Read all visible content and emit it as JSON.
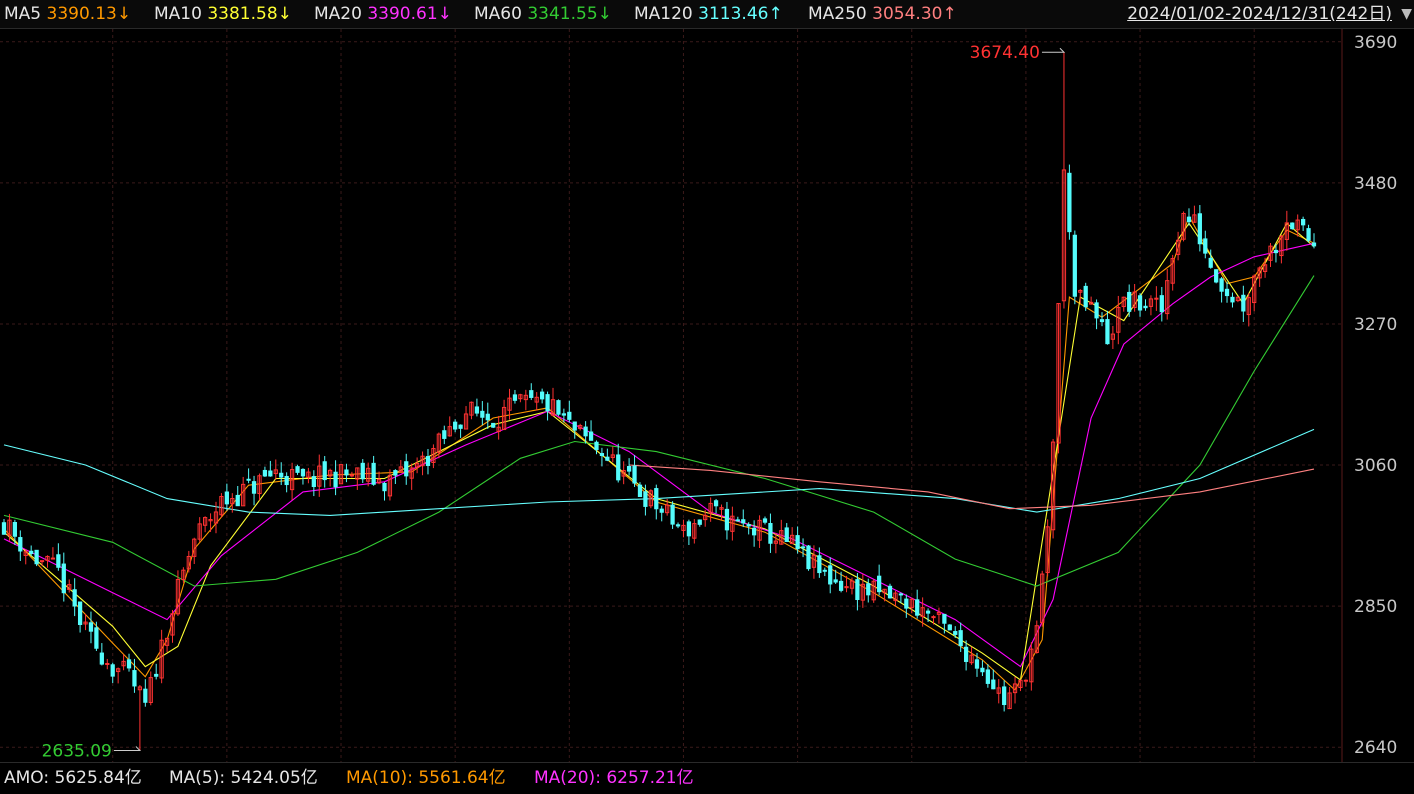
{
  "header": {
    "ma": [
      {
        "name": "MA5",
        "value": "3390.13↓",
        "color": "#ff9900"
      },
      {
        "name": "MA10",
        "value": "3381.58↓",
        "color": "#ffff33"
      },
      {
        "name": "MA20",
        "value": "3390.61↓",
        "color": "#ff00ff"
      },
      {
        "name": "MA60",
        "value": "3341.55↓",
        "color": "#33cc33"
      },
      {
        "name": "MA120",
        "value": "3113.46↑",
        "color": "#66ffff"
      },
      {
        "name": "MA250",
        "value": "3054.30↑",
        "color": "#ff8080"
      }
    ],
    "range": "2024/01/02-2024/12/31(242日)"
  },
  "footer": {
    "amo": "AMO: 5625.84亿",
    "ma5": "MA(5): 5424.05亿",
    "ma10": "MA(10): 5561.64亿",
    "ma20": "MA(20): 6257.21亿"
  },
  "chart_data": {
    "type": "candlestick",
    "y_ticks": [
      2640,
      2850,
      3060,
      3270,
      3480,
      3690
    ],
    "ylim": [
      2618,
      3709
    ],
    "n_bars": 242,
    "high_label": "3674.40",
    "low_label": "2635.09",
    "colors": {
      "up": "#ff3232",
      "down": "#54fcfc",
      "grid": "#3a1a1a",
      "axis_text": "#c8c8c8",
      "high_label": "#ff3232",
      "low_label": "#33cc33"
    },
    "anchors": [
      [
        0,
        2975
      ],
      [
        5,
        2925
      ],
      [
        10,
        2900
      ],
      [
        15,
        2810
      ],
      [
        20,
        2760
      ],
      [
        23,
        2745
      ],
      [
        26,
        2700
      ],
      [
        30,
        2820
      ],
      [
        35,
        2950
      ],
      [
        40,
        3005
      ],
      [
        45,
        3025
      ],
      [
        50,
        3050
      ],
      [
        55,
        3035
      ],
      [
        60,
        3045
      ],
      [
        65,
        3045
      ],
      [
        70,
        3035
      ],
      [
        75,
        3050
      ],
      [
        80,
        3090
      ],
      [
        85,
        3140
      ],
      [
        90,
        3130
      ],
      [
        95,
        3150
      ],
      [
        100,
        3150
      ],
      [
        105,
        3110
      ],
      [
        110,
        3080
      ],
      [
        115,
        3035
      ],
      [
        120,
        3000
      ],
      [
        125,
        2960
      ],
      [
        130,
        2990
      ],
      [
        135,
        2970
      ],
      [
        140,
        2960
      ],
      [
        145,
        2940
      ],
      [
        150,
        2900
      ],
      [
        155,
        2880
      ],
      [
        160,
        2870
      ],
      [
        165,
        2860
      ],
      [
        170,
        2840
      ],
      [
        175,
        2800
      ],
      [
        180,
        2760
      ],
      [
        184,
        2710
      ],
      [
        187,
        2730
      ],
      [
        190,
        2810
      ],
      [
        192,
        2960
      ],
      [
        193,
        3100
      ],
      [
        194,
        3300
      ],
      [
        195,
        3489
      ],
      [
        196,
        3420
      ],
      [
        197,
        3310
      ],
      [
        200,
        3290
      ],
      [
        203,
        3250
      ],
      [
        206,
        3300
      ],
      [
        210,
        3300
      ],
      [
        213,
        3290
      ],
      [
        215,
        3380
      ],
      [
        217,
        3430
      ],
      [
        219,
        3420
      ],
      [
        222,
        3360
      ],
      [
        225,
        3320
      ],
      [
        228,
        3300
      ],
      [
        231,
        3360
      ],
      [
        234,
        3390
      ],
      [
        236,
        3430
      ],
      [
        238,
        3410
      ],
      [
        241,
        3390
      ]
    ],
    "ma_lines": [
      {
        "name": "MA5",
        "color": "#ff9900",
        "points": [
          [
            0,
            2965
          ],
          [
            20,
            2795
          ],
          [
            26,
            2745
          ],
          [
            30,
            2800
          ],
          [
            35,
            2935
          ],
          [
            45,
            3030
          ],
          [
            60,
            3045
          ],
          [
            75,
            3050
          ],
          [
            90,
            3130
          ],
          [
            100,
            3145
          ],
          [
            120,
            3005
          ],
          [
            140,
            2960
          ],
          [
            160,
            2870
          ],
          [
            180,
            2770
          ],
          [
            186,
            2725
          ],
          [
            191,
            2800
          ],
          [
            196,
            3310
          ],
          [
            202,
            3280
          ],
          [
            215,
            3360
          ],
          [
            218,
            3430
          ],
          [
            225,
            3330
          ],
          [
            230,
            3340
          ],
          [
            236,
            3410
          ],
          [
            241,
            3390
          ]
        ]
      },
      {
        "name": "MA10",
        "color": "#ffff33",
        "points": [
          [
            0,
            2960
          ],
          [
            20,
            2820
          ],
          [
            26,
            2760
          ],
          [
            32,
            2790
          ],
          [
            38,
            2910
          ],
          [
            50,
            3040
          ],
          [
            70,
            3040
          ],
          [
            90,
            3120
          ],
          [
            100,
            3140
          ],
          [
            120,
            3010
          ],
          [
            140,
            2965
          ],
          [
            160,
            2880
          ],
          [
            180,
            2780
          ],
          [
            187,
            2740
          ],
          [
            193,
            3050
          ],
          [
            198,
            3310
          ],
          [
            206,
            3275
          ],
          [
            218,
            3420
          ],
          [
            228,
            3300
          ],
          [
            236,
            3420
          ],
          [
            241,
            3385
          ]
        ]
      },
      {
        "name": "MA20",
        "color": "#ff00ff",
        "points": [
          [
            0,
            2950
          ],
          [
            20,
            2870
          ],
          [
            30,
            2830
          ],
          [
            40,
            2925
          ],
          [
            55,
            3020
          ],
          [
            70,
            3035
          ],
          [
            85,
            3090
          ],
          [
            100,
            3140
          ],
          [
            115,
            3080
          ],
          [
            130,
            2990
          ],
          [
            145,
            2950
          ],
          [
            160,
            2890
          ],
          [
            175,
            2830
          ],
          [
            187,
            2760
          ],
          [
            193,
            2860
          ],
          [
            200,
            3130
          ],
          [
            206,
            3240
          ],
          [
            215,
            3300
          ],
          [
            222,
            3340
          ],
          [
            230,
            3370
          ],
          [
            241,
            3390
          ]
        ]
      },
      {
        "name": "MA60",
        "color": "#33cc33",
        "points": [
          [
            0,
            2985
          ],
          [
            20,
            2945
          ],
          [
            35,
            2880
          ],
          [
            50,
            2890
          ],
          [
            65,
            2930
          ],
          [
            80,
            2990
          ],
          [
            95,
            3070
          ],
          [
            105,
            3095
          ],
          [
            120,
            3080
          ],
          [
            140,
            3040
          ],
          [
            160,
            2990
          ],
          [
            175,
            2920
          ],
          [
            190,
            2880
          ],
          [
            205,
            2930
          ],
          [
            220,
            3060
          ],
          [
            230,
            3200
          ],
          [
            241,
            3342
          ]
        ]
      },
      {
        "name": "MA120",
        "color": "#66ffff",
        "points": [
          [
            0,
            3090
          ],
          [
            15,
            3060
          ],
          [
            30,
            3010
          ],
          [
            45,
            2990
          ],
          [
            60,
            2985
          ],
          [
            80,
            2995
          ],
          [
            100,
            3005
          ],
          [
            120,
            3010
          ],
          [
            150,
            3025
          ],
          [
            175,
            3010
          ],
          [
            190,
            2990
          ],
          [
            205,
            3010
          ],
          [
            220,
            3040
          ],
          [
            241,
            3113
          ]
        ]
      },
      {
        "name": "MA250",
        "color": "#ff8080",
        "points": [
          [
            115,
            3060
          ],
          [
            130,
            3052
          ],
          [
            150,
            3035
          ],
          [
            170,
            3020
          ],
          [
            185,
            2995
          ],
          [
            200,
            3000
          ],
          [
            220,
            3020
          ],
          [
            241,
            3054
          ]
        ]
      }
    ]
  }
}
